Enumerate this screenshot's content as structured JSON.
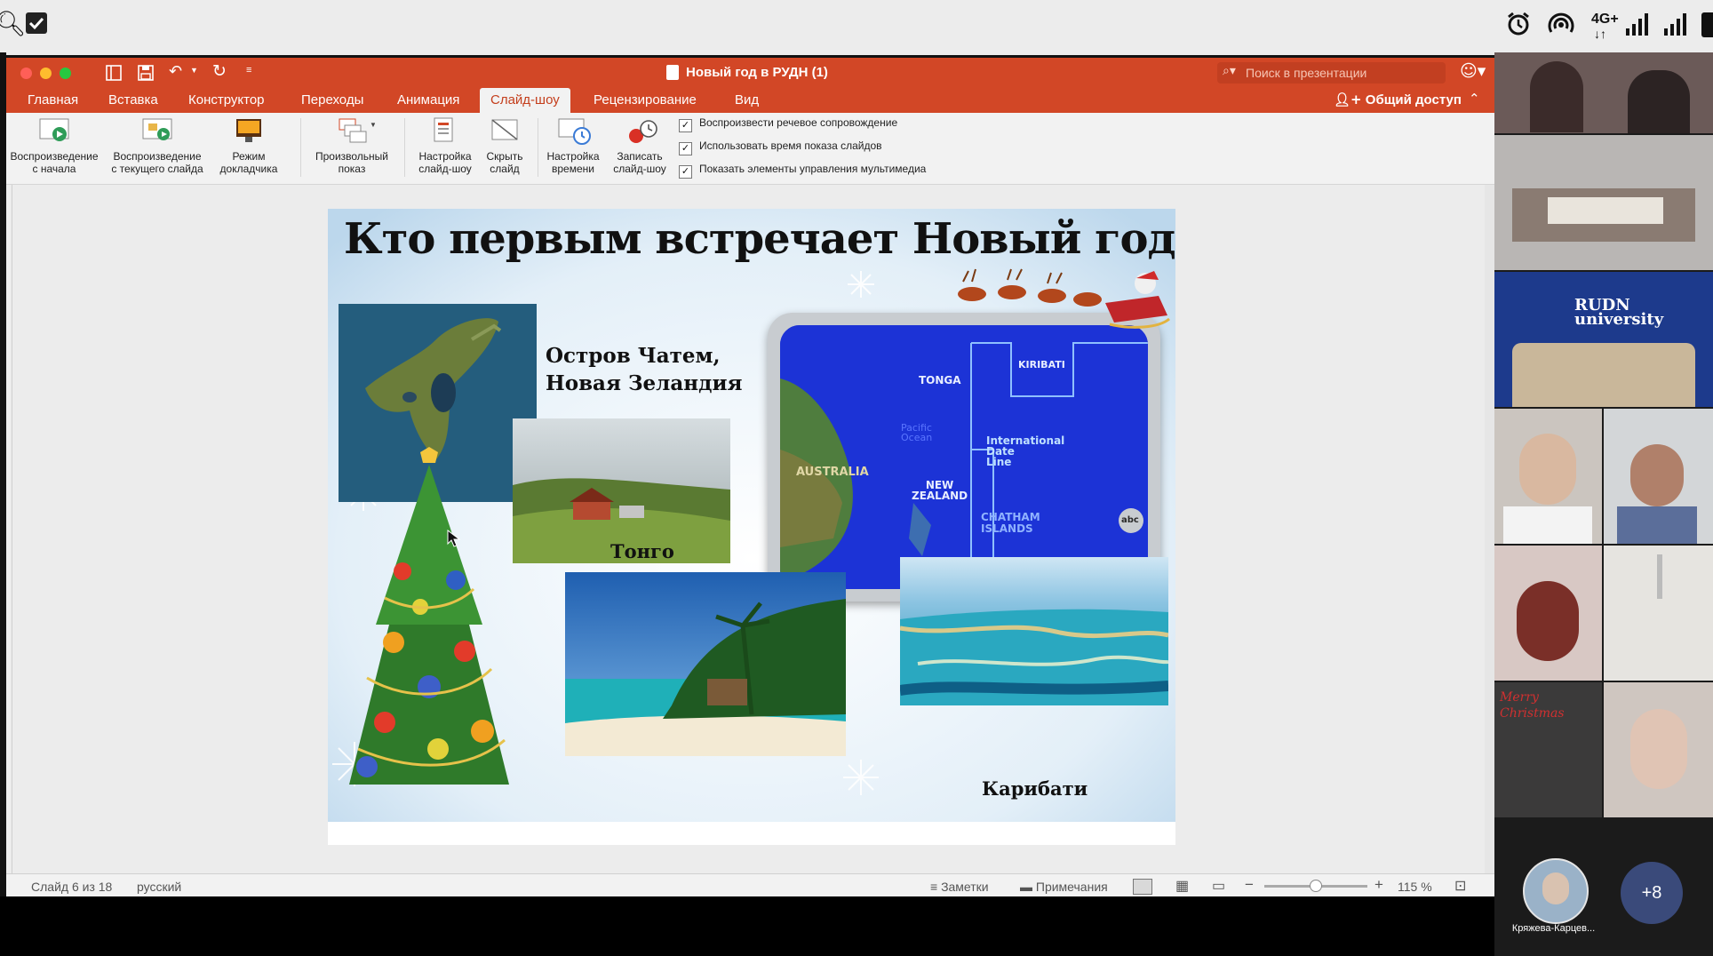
{
  "window": {
    "title": "Новый год в РУДН (1)",
    "search_placeholder": "Поиск в презентации",
    "share_label": "Общий доступ"
  },
  "tabs": [
    "Главная",
    "Вставка",
    "Конструктор",
    "Переходы",
    "Анимация",
    "Слайд-шоу",
    "Рецензирование",
    "Вид"
  ],
  "active_tab": "Слайд-шоу",
  "ribbon": {
    "buttons": [
      {
        "line1": "Воспроизведение",
        "line2": "с начала",
        "icon": "play-from-start-icon"
      },
      {
        "line1": "Воспроизведение",
        "line2": "с текущего слайда",
        "icon": "play-current-icon"
      },
      {
        "line1": "Режим",
        "line2": "докладчика",
        "icon": "presenter-view-icon"
      },
      {
        "line1": "Произвольный",
        "line2": "показ",
        "icon": "custom-show-icon"
      },
      {
        "line1": "Настройка",
        "line2": "слайд-шоу",
        "icon": "setup-show-icon"
      },
      {
        "line1": "Скрыть",
        "line2": "слайд",
        "icon": "hide-slide-icon"
      },
      {
        "line1": "Настройка",
        "line2": "времени",
        "icon": "rehearse-timings-icon"
      },
      {
        "line1": "Записать",
        "line2": "слайд-шоу",
        "icon": "record-show-icon"
      }
    ],
    "checkboxes": [
      {
        "label": "Воспроизвести речевое сопровождение",
        "checked": true
      },
      {
        "label": "Использовать время показа слайдов",
        "checked": true
      },
      {
        "label": "Показать элементы управления мультимедиа",
        "checked": true
      }
    ]
  },
  "slide": {
    "title": "Кто первым встречает Новый год?",
    "caption_chatham_1": "Остров Чатем,",
    "caption_chatham_2": "Новая Зеландия",
    "caption_tonga": "Тонго",
    "caption_kiribati": "Карибати",
    "map_labels": {
      "tonga": "TONGA",
      "kiribati": "KIRIBATI",
      "pacific": "Pacific",
      "ocean": "Ocean",
      "australia": "AUSTRALIA",
      "new": "NEW",
      "zealand": "ZEALAND",
      "idl_1": "International",
      "idl_2": "Date",
      "idl_3": "Line",
      "chatham": "CHATHAM",
      "islands": "ISLANDS",
      "abc": "abc"
    }
  },
  "statusbar": {
    "slide_counter": "Слайд 6 из 18",
    "language": "русский",
    "notes_label": "Заметки",
    "comments_label": "Примечания",
    "zoom": "115 %"
  },
  "phone_status": {
    "network": "4G+"
  },
  "video_call": {
    "participant_name": "Кряжева-Карцев...",
    "more_count": "+8",
    "rudn_text_1": "RUDN",
    "rudn_text_2": "university",
    "merry_1": "Merry",
    "merry_2": "Christmas"
  },
  "colors": {
    "accent": "#d24726",
    "slide_title": "#111111",
    "map_blue": "#1a2fd0"
  }
}
